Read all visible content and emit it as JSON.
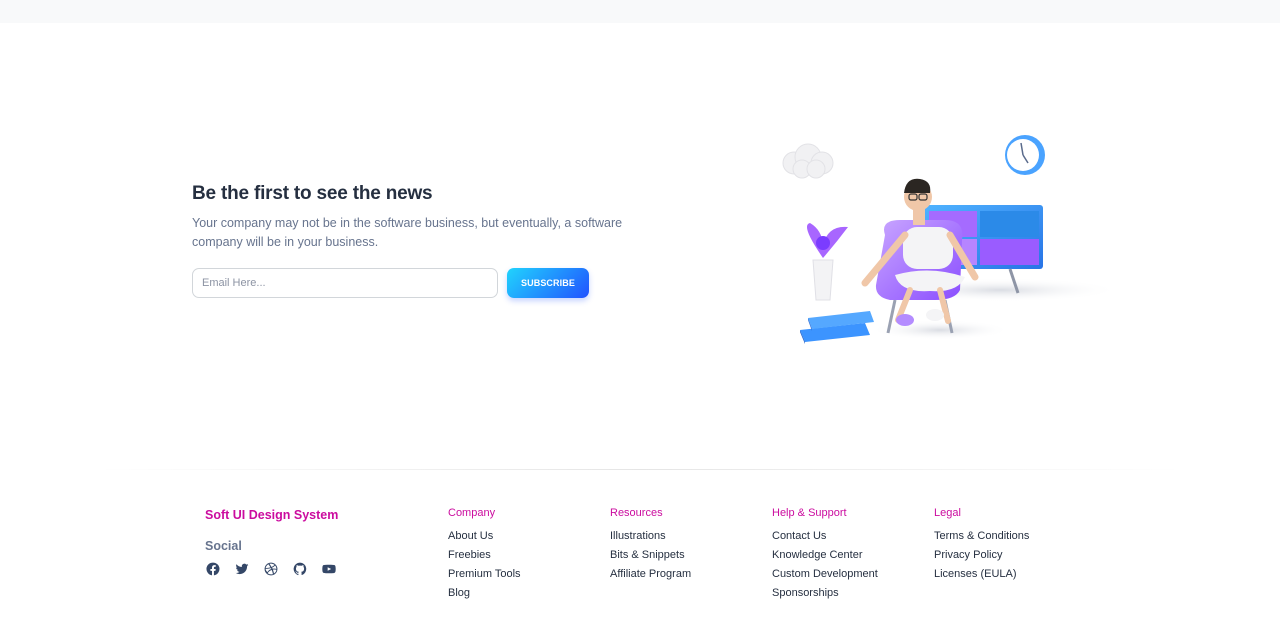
{
  "newsletter": {
    "title": "Be the first to see the news",
    "text": "Your company may not be in the software business, but eventually, a software company will be in your business.",
    "email_placeholder": "Email Here...",
    "subscribe_label": "SUBSCRIBE"
  },
  "footer": {
    "brand": "Soft UI Design System",
    "social_title": "Social",
    "social_icons": [
      "facebook-icon",
      "twitter-icon",
      "dribbble-icon",
      "github-icon",
      "youtube-icon"
    ],
    "columns": [
      {
        "title": "Company",
        "links": [
          "About Us",
          "Freebies",
          "Premium Tools",
          "Blog"
        ]
      },
      {
        "title": "Resources",
        "links": [
          "Illustrations",
          "Bits & Snippets",
          "Affiliate Program"
        ]
      },
      {
        "title": "Help & Support",
        "links": [
          "Contact Us",
          "Knowledge Center",
          "Custom Development",
          "Sponsorships"
        ]
      },
      {
        "title": "Legal",
        "links": [
          "Terms & Conditions",
          "Privacy Policy",
          "Licenses (EULA)"
        ]
      }
    ]
  },
  "colors": {
    "accent": "#cb0c9f",
    "button_gradient_start": "#21d4fd",
    "button_gradient_end": "#2152ff"
  }
}
